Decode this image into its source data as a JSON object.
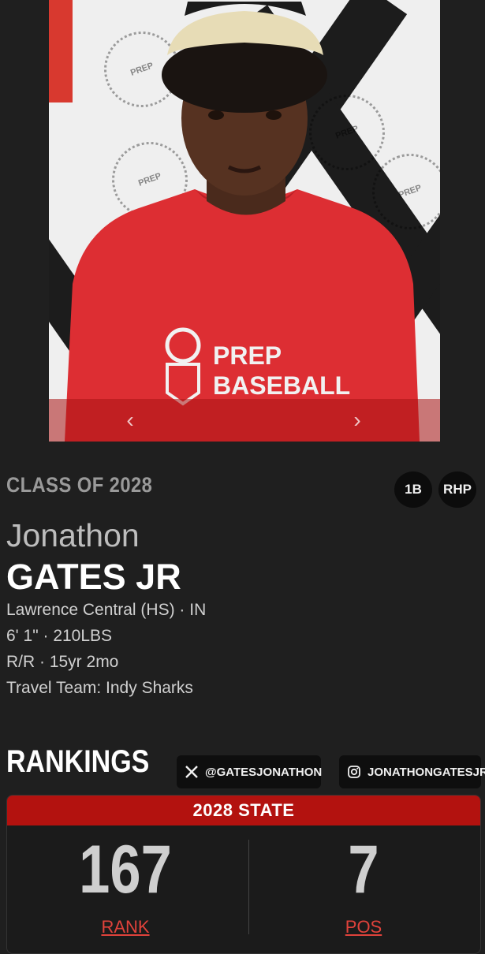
{
  "player": {
    "class_label": "CLASS OF 2028",
    "positions": [
      "1B",
      "RHP"
    ],
    "first_name": "Jonathon",
    "last_name": "GATES JR",
    "school": "Lawrence Central (HS) · IN",
    "size": "6' 1\" · 210LBS",
    "bats_age": "R/R · 15yr 2mo",
    "travel_team": "Travel Team: Indy Sharks"
  },
  "carousel": {
    "prev_icon": "chevron-left-icon",
    "next_icon": "chevron-right-icon",
    "shirt_text": [
      "PREP",
      "BASEBALL"
    ]
  },
  "rankings": {
    "title": "RANKINGS",
    "social": [
      {
        "icon": "x-icon",
        "handle": "@GATESJONATHON"
      },
      {
        "icon": "instagram-icon",
        "handle": "JONATHONGATESJR"
      }
    ],
    "card_title": "2028 STATE",
    "rank_value": "167",
    "rank_label": "RANK",
    "pos_value": "7",
    "pos_label": "POS"
  },
  "colors": {
    "accent_red": "#b3120f",
    "link_red": "#e0423b",
    "background": "#1f1f1f"
  }
}
